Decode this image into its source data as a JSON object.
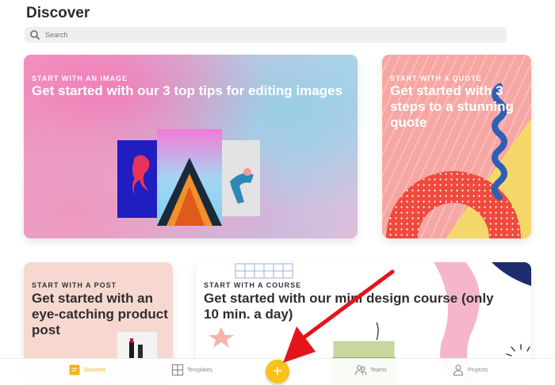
{
  "header": {
    "title": "Discover"
  },
  "search": {
    "placeholder": "Search"
  },
  "cards": [
    {
      "eyebrow": "START WITH AN IMAGE",
      "title": "Get started with our 3 top tips for editing images"
    },
    {
      "eyebrow": "START WITH A QUOTE",
      "title": "Get started with 3 steps to a stunning quote"
    },
    {
      "eyebrow": "START WITH A POST",
      "title": "Get started with an eye-catching product post"
    },
    {
      "eyebrow": "START WITH A COURSE",
      "title": "Get started with our mini design course (only 10 min. a day)"
    }
  ],
  "tabbar": {
    "items": [
      {
        "label": "Discover",
        "icon": "discover-icon",
        "active": true
      },
      {
        "label": "Templates",
        "icon": "templates-icon",
        "active": false
      },
      {
        "label": "Teams",
        "icon": "teams-icon",
        "active": false
      },
      {
        "label": "Projects",
        "icon": "projects-icon",
        "active": false
      }
    ],
    "create_label": "+"
  },
  "colors": {
    "accent": "#f7c21c",
    "arrow": "#e5141b"
  }
}
